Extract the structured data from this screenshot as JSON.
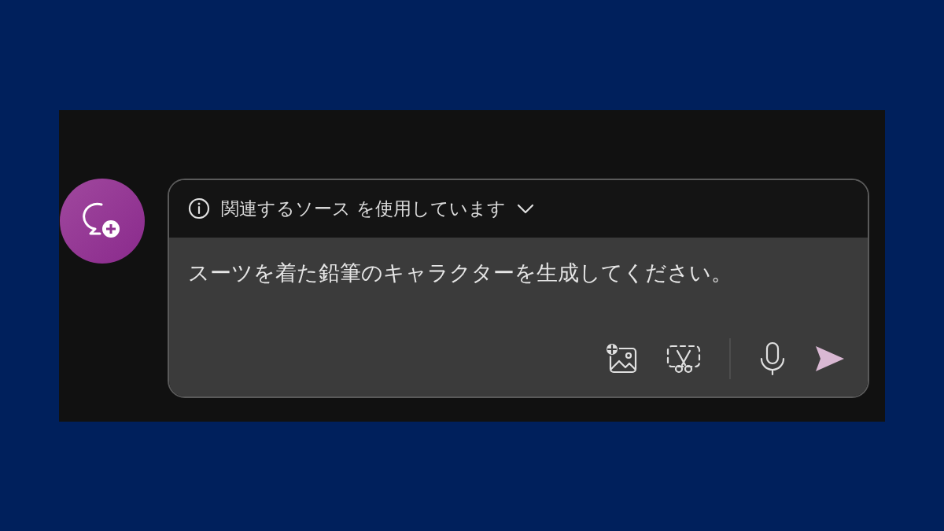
{
  "sources_banner": {
    "label": "関連するソース を使用しています",
    "expanded": false
  },
  "prompt": {
    "value": "スーツを着た鉛筆のキャラクターを生成してください。"
  },
  "toolbar": [
    {
      "kind": "add-image"
    },
    {
      "kind": "screenshot"
    },
    {
      "kind": "divider"
    },
    {
      "kind": "mic"
    },
    {
      "kind": "send"
    }
  ]
}
